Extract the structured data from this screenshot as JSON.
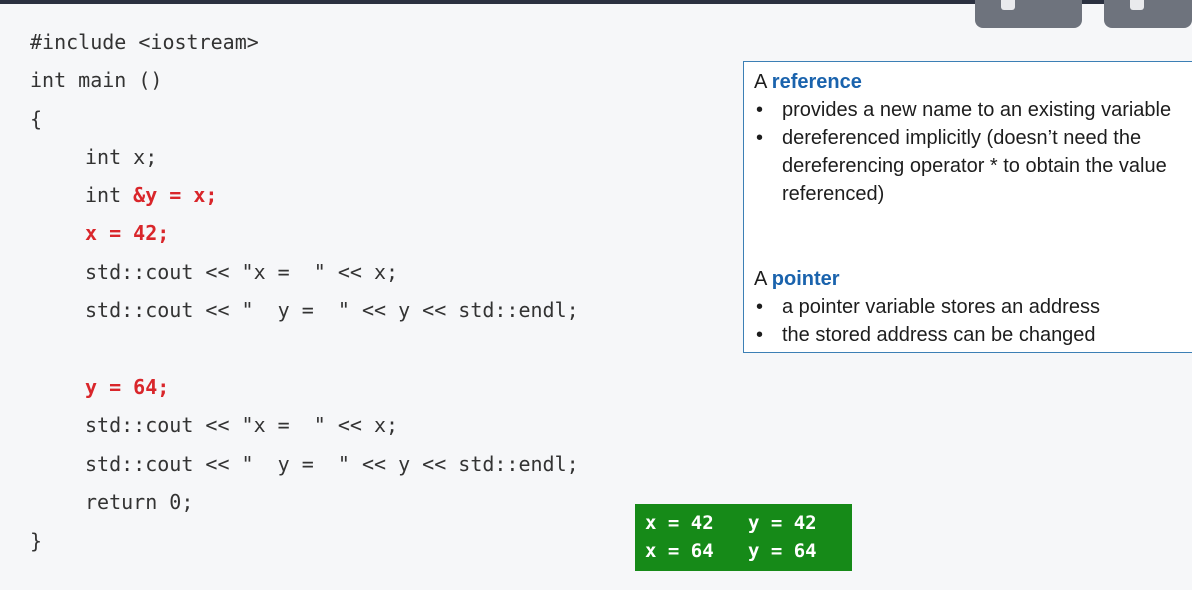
{
  "code": {
    "lines": [
      "#include <iostream>",
      "int main ()",
      "{",
      "int x;",
      "int ",
      "&y = x;",
      "x = 42;",
      "std::cout << \"x =  \" << x;",
      "std::cout << \"  y =  \" << y << std::endl;",
      "y = 64;",
      "std::cout << \"x =  \" << x;",
      "std::cout << \"  y =  \" << y << std::endl;",
      "return 0;",
      "}"
    ]
  },
  "info": {
    "reference": {
      "prefix": "A ",
      "keyword": "reference",
      "points": [
        "provides a new name to an existing variable",
        "dereferenced implicitly (doesn’t need the dereferencing operator * to obtain the value referenced)"
      ]
    },
    "pointer": {
      "prefix": "A ",
      "keyword": "pointer",
      "points": [
        "a pointer variable stores an address",
        "the stored address can be changed"
      ]
    },
    "bullet": "•"
  },
  "output": {
    "lines": [
      "x = 42   y = 42",
      "x = 64   y = 64"
    ]
  },
  "colors": {
    "highlight": "#d9262b",
    "keyword": "#1a63ad",
    "box_border": "#3c7fb5",
    "output_bg": "#168a18"
  }
}
